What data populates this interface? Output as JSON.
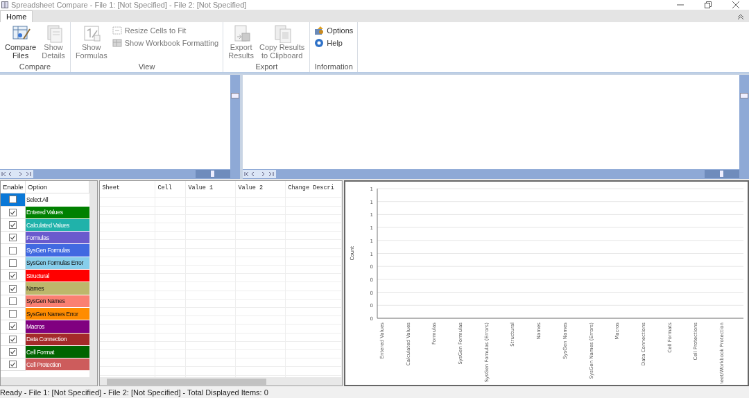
{
  "window": {
    "title": "Spreadsheet Compare - File 1: [Not Specified] - File 2: [Not Specified]"
  },
  "tabs": [
    {
      "label": "Home",
      "selected": true
    }
  ],
  "ribbon": {
    "groups": [
      {
        "label": "Compare",
        "items": [
          {
            "kind": "large",
            "label": "Compare\nFiles",
            "disabled": false
          },
          {
            "kind": "large",
            "label": "Show\nDetails",
            "disabled": true
          }
        ]
      },
      {
        "label": "View",
        "items": [
          {
            "kind": "large",
            "label": "Show\nFormulas",
            "disabled": true
          },
          {
            "kind": "small",
            "label": "Resize Cells to Fit",
            "disabled": true
          },
          {
            "kind": "small",
            "label": "Show Workbook Formatting",
            "disabled": true
          }
        ]
      },
      {
        "label": "Export",
        "items": [
          {
            "kind": "large",
            "label": "Export\nResults",
            "disabled": true
          },
          {
            "kind": "large",
            "label": "Copy Results\nto Clipboard",
            "disabled": true
          }
        ]
      },
      {
        "label": "Information",
        "items": [
          {
            "kind": "small",
            "label": "Options",
            "disabled": false
          },
          {
            "kind": "small",
            "label": "Help",
            "disabled": false
          }
        ]
      }
    ]
  },
  "options": {
    "columns": [
      "Enable",
      "Option"
    ],
    "rows": [
      {
        "label": "Select All",
        "checked": false,
        "selected": true,
        "color": "#ffffff"
      },
      {
        "label": "Entered Values",
        "checked": true,
        "selected": false,
        "color": "#008000"
      },
      {
        "label": "Calculated Values",
        "checked": true,
        "selected": false,
        "color": "#20b2aa"
      },
      {
        "label": "Formulas",
        "checked": true,
        "selected": false,
        "color": "#6a5acd"
      },
      {
        "label": "SysGen Formulas",
        "checked": false,
        "selected": false,
        "color": "#4169e1"
      },
      {
        "label": "SysGen Formulas Error",
        "checked": false,
        "selected": false,
        "color": "#87ceeb"
      },
      {
        "label": "Structural",
        "checked": true,
        "selected": false,
        "color": "#ff0000"
      },
      {
        "label": "Names",
        "checked": true,
        "selected": false,
        "color": "#bdb76b"
      },
      {
        "label": "SysGen Names",
        "checked": false,
        "selected": false,
        "color": "#fa8072"
      },
      {
        "label": "SysGen Names Error",
        "checked": false,
        "selected": false,
        "color": "#ff8c00"
      },
      {
        "label": "Macros",
        "checked": true,
        "selected": false,
        "color": "#800080"
      },
      {
        "label": "Data Connection",
        "checked": true,
        "selected": false,
        "color": "#a52a2a"
      },
      {
        "label": "Cell Format",
        "checked": true,
        "selected": false,
        "color": "#006400"
      },
      {
        "label": "Cell Protection",
        "checked": true,
        "selected": false,
        "color": "#cd5c5c"
      }
    ]
  },
  "results": {
    "columns": [
      "Sheet",
      "Cell",
      "Value 1",
      "Value 2",
      "Change Descri"
    ]
  },
  "chart": {
    "chart_data": {
      "type": "bar",
      "ylabel": "Count",
      "grid": true,
      "categories": [
        "Entered Values",
        "Calculated Values",
        "Formulas",
        "SysGen Formulas",
        "SysGen Fomulas (Errors)",
        "Structural",
        "Names",
        "SysGen Names",
        "SysGen Names (Errors)",
        "Macros",
        "Data Connections",
        "Cell Formats",
        "Cell Protections",
        "heet/Workbook Protection"
      ],
      "values": [
        0,
        0,
        0,
        0,
        0,
        0,
        0,
        0,
        0,
        0,
        0,
        0,
        0,
        0
      ],
      "ylim": [
        0,
        1
      ],
      "yticks": [
        {
          "value": 0,
          "label": "0"
        },
        {
          "value": 0.1,
          "label": "0"
        },
        {
          "value": 0.2,
          "label": "0"
        },
        {
          "value": 0.3,
          "label": "0"
        },
        {
          "value": 0.4,
          "label": "0"
        },
        {
          "value": 0.5,
          "label": "1"
        },
        {
          "value": 0.6,
          "label": "1"
        },
        {
          "value": 0.7,
          "label": "1"
        },
        {
          "value": 0.8,
          "label": "1"
        },
        {
          "value": 0.9,
          "label": "1"
        },
        {
          "value": 1,
          "label": "1"
        }
      ]
    }
  },
  "status_bar": {
    "text": "Ready - File 1: [Not Specified] - File 2: [Not Specified] - Total Displayed Items: 0"
  }
}
